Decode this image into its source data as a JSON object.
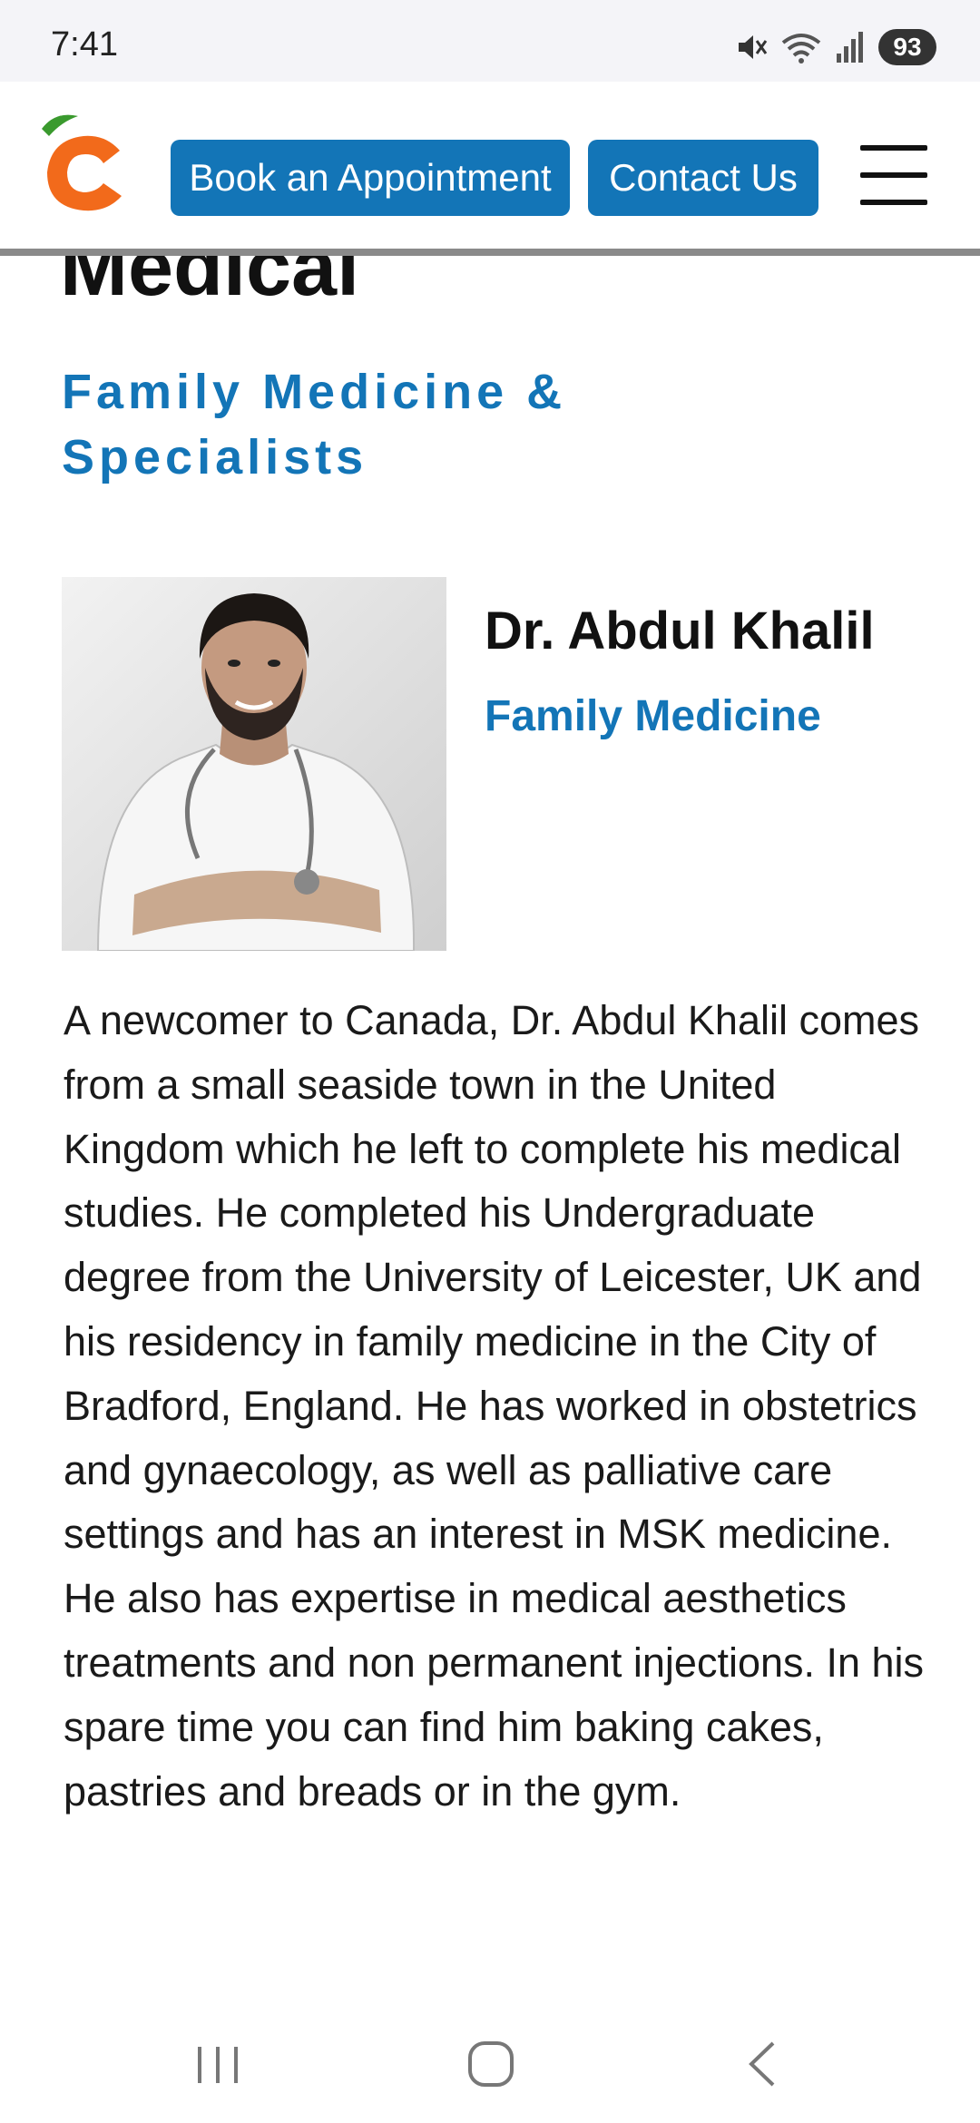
{
  "status_bar": {
    "time": "7:41",
    "battery": "93",
    "icons": [
      "mute-icon",
      "wifi-icon",
      "signal-icon",
      "battery-icon"
    ]
  },
  "header": {
    "logo": "clinic-logo",
    "book_label": "Book an Appointment",
    "contact_label": "Contact Us",
    "menu_icon": "hamburger-menu-icon",
    "accent_color": "#1375b7"
  },
  "page": {
    "title_partial": "Medical",
    "tagline": "Family Medicine & Specialists"
  },
  "doctor": {
    "photo": "doctor-portrait",
    "name": "Dr. Abdul Khalil",
    "specialty": "Family Medicine",
    "bio": "A newcomer to Canada, Dr. Abdul Khalil comes from a small seaside town in the United Kingdom which he left to complete his medical studies. He completed his Undergraduate degree from the University of Leicester, UK and his residency in family medicine in the City of Bradford, England. He has worked in obstetrics and gynaecology, as well as palliative care settings and has an interest in MSK medicine. He also has expertise in medical aesthetics treatments and non permanent injections.  In his spare time you can find him baking cakes, pastries and breads or in the gym."
  },
  "nav": {
    "recents": "recent-apps-icon",
    "home": "home-icon",
    "back": "back-icon"
  }
}
